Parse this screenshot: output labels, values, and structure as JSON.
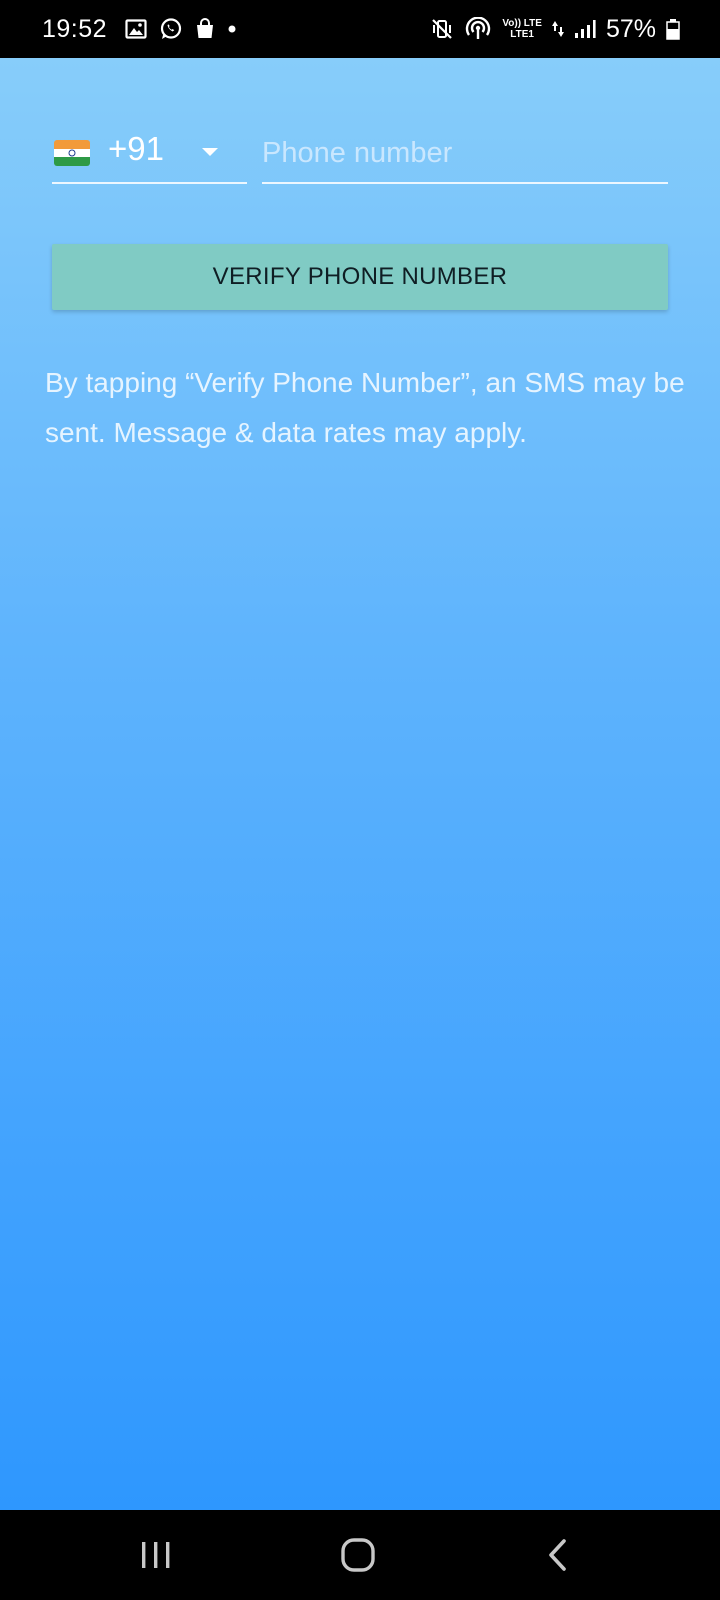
{
  "status_bar": {
    "time": "19:52",
    "battery_percent": "57%",
    "network_top": "Vo)) LTE",
    "network_bottom": "LTE1",
    "left_icons": [
      "gallery-icon",
      "whatsapp-icon",
      "shopping-bag-icon",
      "notification-dot-icon"
    ],
    "right_icons": [
      "mute-vibrate-icon",
      "hotspot-icon",
      "volte-icon",
      "signal-icon",
      "battery-icon"
    ]
  },
  "phone_form": {
    "country_flag": "india-flag-icon",
    "country_code": "+91",
    "phone_placeholder": "Phone number",
    "phone_value": ""
  },
  "verify_button": {
    "label": "VERIFY PHONE NUMBER"
  },
  "disclaimer": {
    "text": "By tapping “Verify Phone Number”, an SMS may be sent. Message & data rates may apply."
  },
  "nav_bar": {
    "buttons": [
      "recents-icon",
      "home-icon",
      "back-icon"
    ]
  },
  "colors": {
    "gradient_top": "#87cdfa",
    "gradient_bottom": "#2e97fe",
    "button_bg": "#80cbc4",
    "button_text": "#0f1e24"
  }
}
